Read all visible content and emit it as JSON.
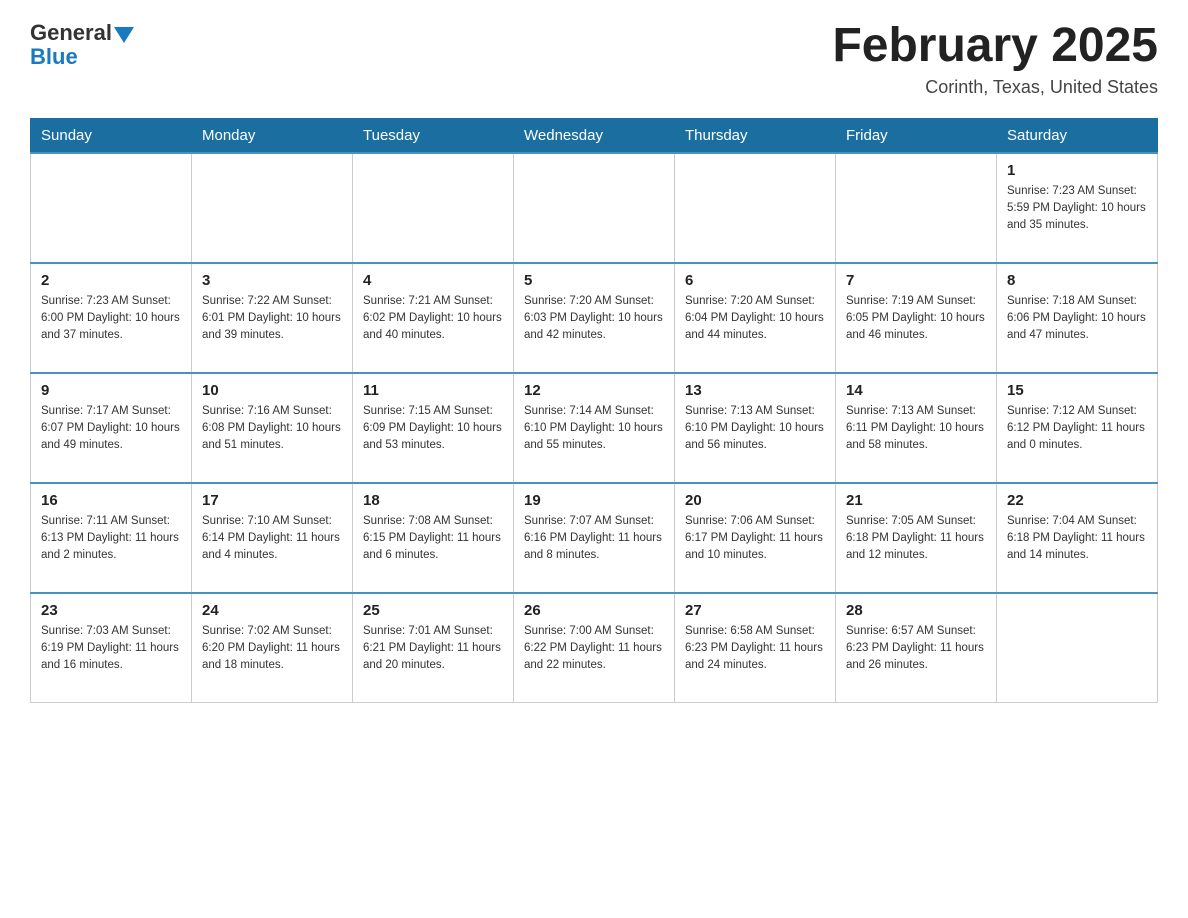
{
  "header": {
    "logo_general": "General",
    "logo_blue": "Blue",
    "month_title": "February 2025",
    "location": "Corinth, Texas, United States"
  },
  "weekdays": [
    "Sunday",
    "Monday",
    "Tuesday",
    "Wednesday",
    "Thursday",
    "Friday",
    "Saturday"
  ],
  "weeks": [
    [
      {
        "day": "",
        "info": ""
      },
      {
        "day": "",
        "info": ""
      },
      {
        "day": "",
        "info": ""
      },
      {
        "day": "",
        "info": ""
      },
      {
        "day": "",
        "info": ""
      },
      {
        "day": "",
        "info": ""
      },
      {
        "day": "1",
        "info": "Sunrise: 7:23 AM\nSunset: 5:59 PM\nDaylight: 10 hours and 35 minutes."
      }
    ],
    [
      {
        "day": "2",
        "info": "Sunrise: 7:23 AM\nSunset: 6:00 PM\nDaylight: 10 hours and 37 minutes."
      },
      {
        "day": "3",
        "info": "Sunrise: 7:22 AM\nSunset: 6:01 PM\nDaylight: 10 hours and 39 minutes."
      },
      {
        "day": "4",
        "info": "Sunrise: 7:21 AM\nSunset: 6:02 PM\nDaylight: 10 hours and 40 minutes."
      },
      {
        "day": "5",
        "info": "Sunrise: 7:20 AM\nSunset: 6:03 PM\nDaylight: 10 hours and 42 minutes."
      },
      {
        "day": "6",
        "info": "Sunrise: 7:20 AM\nSunset: 6:04 PM\nDaylight: 10 hours and 44 minutes."
      },
      {
        "day": "7",
        "info": "Sunrise: 7:19 AM\nSunset: 6:05 PM\nDaylight: 10 hours and 46 minutes."
      },
      {
        "day": "8",
        "info": "Sunrise: 7:18 AM\nSunset: 6:06 PM\nDaylight: 10 hours and 47 minutes."
      }
    ],
    [
      {
        "day": "9",
        "info": "Sunrise: 7:17 AM\nSunset: 6:07 PM\nDaylight: 10 hours and 49 minutes."
      },
      {
        "day": "10",
        "info": "Sunrise: 7:16 AM\nSunset: 6:08 PM\nDaylight: 10 hours and 51 minutes."
      },
      {
        "day": "11",
        "info": "Sunrise: 7:15 AM\nSunset: 6:09 PM\nDaylight: 10 hours and 53 minutes."
      },
      {
        "day": "12",
        "info": "Sunrise: 7:14 AM\nSunset: 6:10 PM\nDaylight: 10 hours and 55 minutes."
      },
      {
        "day": "13",
        "info": "Sunrise: 7:13 AM\nSunset: 6:10 PM\nDaylight: 10 hours and 56 minutes."
      },
      {
        "day": "14",
        "info": "Sunrise: 7:13 AM\nSunset: 6:11 PM\nDaylight: 10 hours and 58 minutes."
      },
      {
        "day": "15",
        "info": "Sunrise: 7:12 AM\nSunset: 6:12 PM\nDaylight: 11 hours and 0 minutes."
      }
    ],
    [
      {
        "day": "16",
        "info": "Sunrise: 7:11 AM\nSunset: 6:13 PM\nDaylight: 11 hours and 2 minutes."
      },
      {
        "day": "17",
        "info": "Sunrise: 7:10 AM\nSunset: 6:14 PM\nDaylight: 11 hours and 4 minutes."
      },
      {
        "day": "18",
        "info": "Sunrise: 7:08 AM\nSunset: 6:15 PM\nDaylight: 11 hours and 6 minutes."
      },
      {
        "day": "19",
        "info": "Sunrise: 7:07 AM\nSunset: 6:16 PM\nDaylight: 11 hours and 8 minutes."
      },
      {
        "day": "20",
        "info": "Sunrise: 7:06 AM\nSunset: 6:17 PM\nDaylight: 11 hours and 10 minutes."
      },
      {
        "day": "21",
        "info": "Sunrise: 7:05 AM\nSunset: 6:18 PM\nDaylight: 11 hours and 12 minutes."
      },
      {
        "day": "22",
        "info": "Sunrise: 7:04 AM\nSunset: 6:18 PM\nDaylight: 11 hours and 14 minutes."
      }
    ],
    [
      {
        "day": "23",
        "info": "Sunrise: 7:03 AM\nSunset: 6:19 PM\nDaylight: 11 hours and 16 minutes."
      },
      {
        "day": "24",
        "info": "Sunrise: 7:02 AM\nSunset: 6:20 PM\nDaylight: 11 hours and 18 minutes."
      },
      {
        "day": "25",
        "info": "Sunrise: 7:01 AM\nSunset: 6:21 PM\nDaylight: 11 hours and 20 minutes."
      },
      {
        "day": "26",
        "info": "Sunrise: 7:00 AM\nSunset: 6:22 PM\nDaylight: 11 hours and 22 minutes."
      },
      {
        "day": "27",
        "info": "Sunrise: 6:58 AM\nSunset: 6:23 PM\nDaylight: 11 hours and 24 minutes."
      },
      {
        "day": "28",
        "info": "Sunrise: 6:57 AM\nSunset: 6:23 PM\nDaylight: 11 hours and 26 minutes."
      },
      {
        "day": "",
        "info": ""
      }
    ]
  ]
}
